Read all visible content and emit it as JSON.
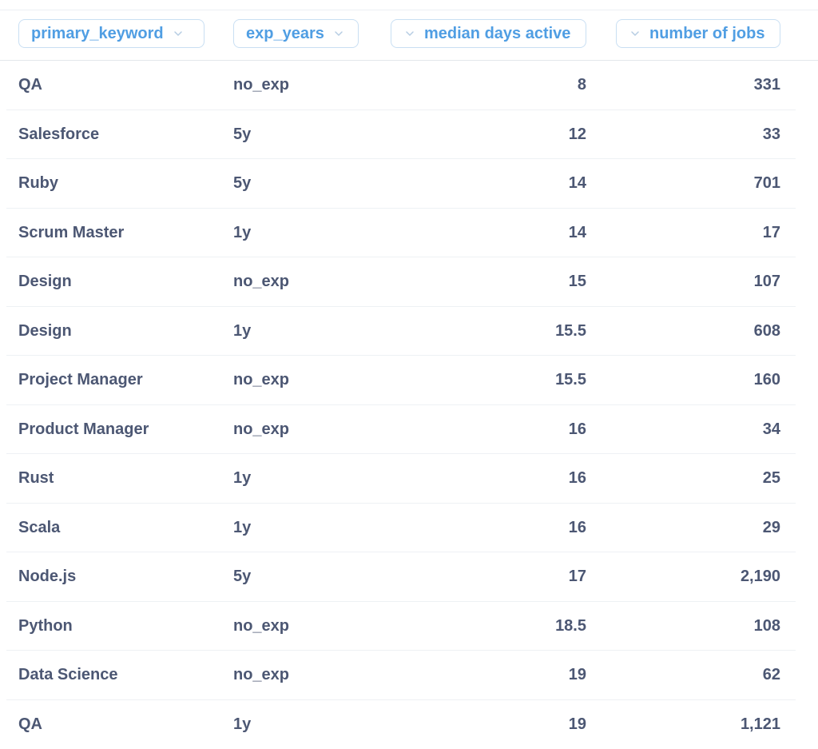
{
  "table": {
    "columns": [
      {
        "label": "primary_keyword",
        "icon": "chevron-down-icon"
      },
      {
        "label": "exp_years",
        "icon": "chevron-down-icon"
      },
      {
        "label": "median days active",
        "icon": "chevron-down-icon"
      },
      {
        "label": "number of jobs",
        "icon": "chevron-down-icon"
      }
    ],
    "rows": [
      [
        "QA",
        "no_exp",
        "8",
        "331"
      ],
      [
        "Salesforce",
        "5y",
        "12",
        "33"
      ],
      [
        "Ruby",
        "5y",
        "14",
        "701"
      ],
      [
        "Scrum Master",
        "1y",
        "14",
        "17"
      ],
      [
        "Design",
        "no_exp",
        "15",
        "107"
      ],
      [
        "Design",
        "1y",
        "15.5",
        "608"
      ],
      [
        "Project Manager",
        "no_exp",
        "15.5",
        "160"
      ],
      [
        "Product Manager",
        "no_exp",
        "16",
        "34"
      ],
      [
        "Rust",
        "1y",
        "16",
        "25"
      ],
      [
        "Scala",
        "1y",
        "16",
        "29"
      ],
      [
        "Node.js",
        "5y",
        "17",
        "2,190"
      ],
      [
        "Python",
        "no_exp",
        "18.5",
        "108"
      ],
      [
        "Data Science",
        "no_exp",
        "19",
        "62"
      ],
      [
        "QA",
        "1y",
        "19",
        "1,121"
      ]
    ]
  },
  "colors": {
    "header_text": "#509ee3",
    "header_border": "#c9dff3",
    "cell_text": "#4c5773"
  }
}
